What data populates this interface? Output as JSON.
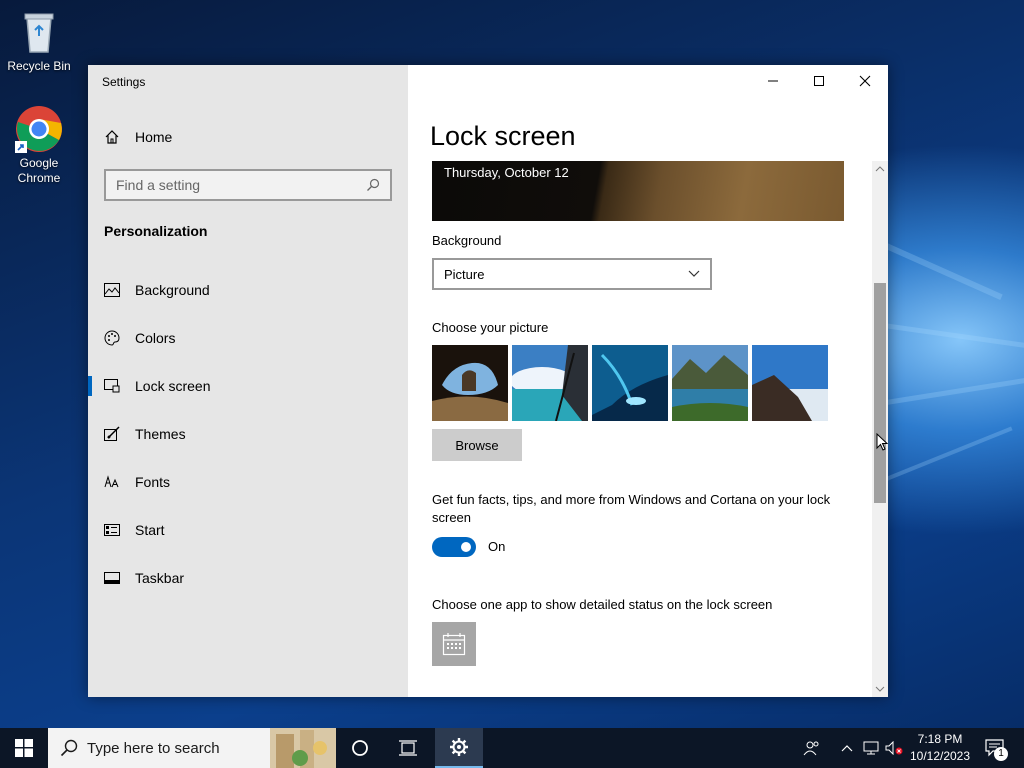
{
  "desktop": {
    "icons": [
      {
        "label": "Recycle Bin"
      },
      {
        "label": "Google Chrome"
      }
    ]
  },
  "window": {
    "title": "Settings",
    "controls": {
      "minimize": "minimize-icon",
      "maximize": "maximize-icon",
      "close": "close-icon"
    }
  },
  "nav": {
    "home_label": "Home",
    "search_placeholder": "Find a setting",
    "section_title": "Personalization",
    "items": [
      {
        "label": "Background",
        "icon": "picture-icon"
      },
      {
        "label": "Colors",
        "icon": "palette-icon"
      },
      {
        "label": "Lock screen",
        "icon": "lock-screen-icon",
        "active": true
      },
      {
        "label": "Themes",
        "icon": "brush-icon"
      },
      {
        "label": "Fonts",
        "icon": "font-icon"
      },
      {
        "label": "Start",
        "icon": "start-icon"
      },
      {
        "label": "Taskbar",
        "icon": "taskbar-icon"
      }
    ]
  },
  "content": {
    "title": "Lock screen",
    "preview_date": "Thursday, October 12",
    "background_label": "Background",
    "background_value": "Picture",
    "choose_picture_label": "Choose your picture",
    "browse_label": "Browse",
    "fun_facts_text": "Get fun facts, tips, and more from Windows and Cortana on your lock screen",
    "toggle_state": "On",
    "detailed_status_label": "Choose one app to show detailed status on the lock screen"
  },
  "taskbar": {
    "search_placeholder": "Type here to search",
    "time": "7:18 PM",
    "date": "10/12/2023",
    "notification_count": "1"
  },
  "colors": {
    "accent": "#0067c0",
    "nav_bg": "#e6e6e6",
    "taskbar_bg": "#0c1626"
  }
}
